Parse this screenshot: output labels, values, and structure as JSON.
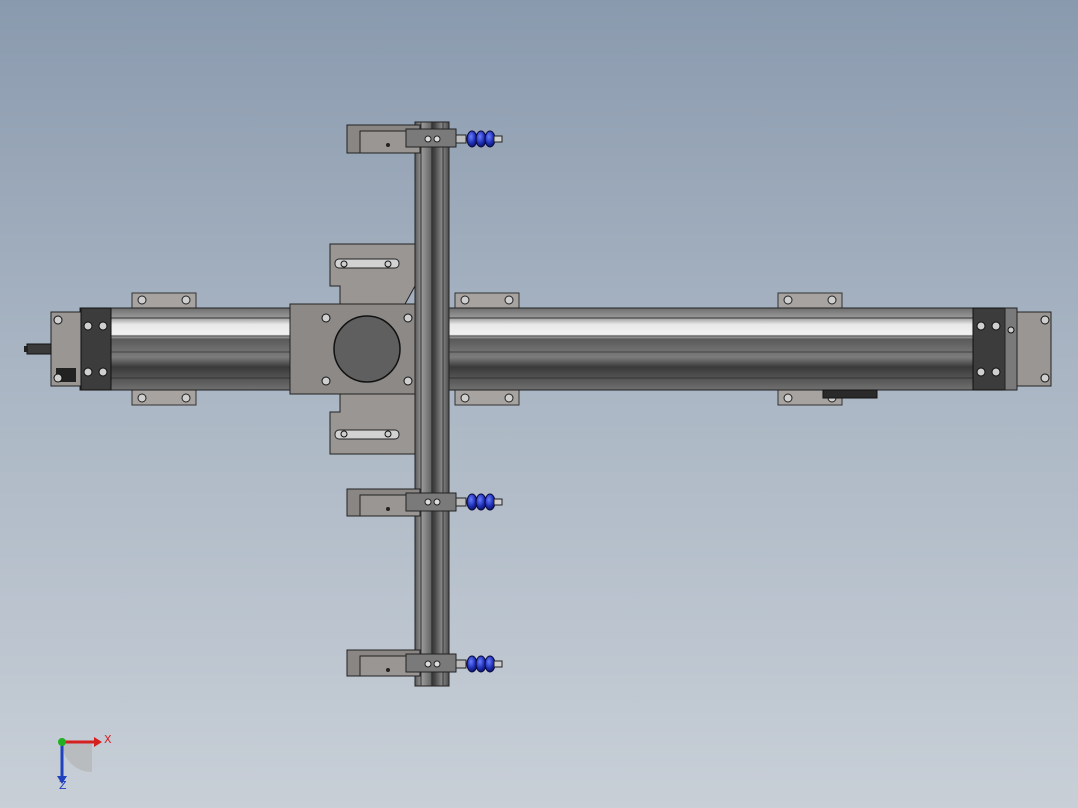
{
  "viewport": {
    "background_top": "#8a9aae",
    "background_bottom": "#c8cfd7"
  },
  "model": {
    "description_icon": "linear-axis-gantry-model",
    "colors": {
      "frame_gray": "#8c8c8c",
      "plate_gray": "#9e9a98",
      "dark_steel": "#4a4a4a",
      "rail_white": "#e8e8e8",
      "cylinder_blue": "#1e2fb4"
    }
  },
  "triad": {
    "x_label": "X",
    "z_label": "Z",
    "x_color": "#d62020",
    "y_color": "#20b020",
    "z_color": "#2040c0"
  }
}
